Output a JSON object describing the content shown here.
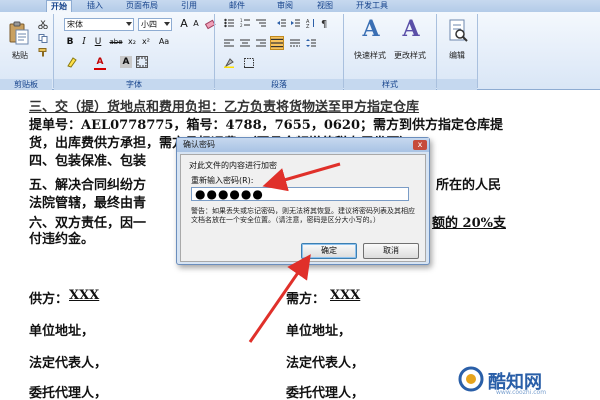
{
  "ribbon": {
    "tabs": [
      "开始",
      "插入",
      "页面布局",
      "引用",
      "邮件",
      "审阅",
      "视图",
      "开发工具"
    ],
    "active_tab": "开始",
    "clipboard": {
      "paste_label": "粘贴",
      "group_label": "剪贴板"
    },
    "font": {
      "font_name": "宋体",
      "font_size": "小四",
      "group_label": "字体",
      "buttons": [
        "B",
        "I",
        "U",
        "abe",
        "x₂",
        "x²",
        "Aa",
        "A",
        "A"
      ]
    },
    "paragraph": {
      "group_label": "段落"
    },
    "styles": {
      "quick_styles_label": "快速样式",
      "change_styles_label": "更改样式",
      "group_label": "样式"
    },
    "editing": {
      "label": "编辑"
    }
  },
  "document": {
    "lines": [
      "三、交（提）货地点和费用负担：乙方负责将货物送至甲方指定仓库",
      "提单号：AEL0778775，箱号：4788，7655，0620；需方到供方指定仓库提",
      "货，出库费供方承担，需方承担运费。（开具全额增值税专用发票）。",
      "四、包装保准、包装",
      "五、解决合同纠纷方",
      "法院管辖，最终由青",
      "六、双方责任，因一",
      "付违约金。"
    ],
    "right_fragments": [
      "所在的人民",
      "额的 20%支"
    ],
    "signature": {
      "buyer_label": "供方：",
      "buyer_value": "XXX",
      "seller_label": "需方：",
      "seller_value": "XXX",
      "address_label": "单位地址，",
      "legal_rep_label": "法定代表人，",
      "agent_label": "委托代理人，"
    }
  },
  "dialog": {
    "title": "确认密码",
    "close": "x",
    "description": "对此文件的内容进行加密",
    "prompt": "重新输入密码(R):",
    "password": "●●●●●●",
    "warning": "警告：如果丢失或忘记密码，则无法将其恢复。建议将密码列表及其相应文档名放在一个安全位置。（请注意，密码是区分大小写的。）",
    "ok_label": "确定",
    "cancel_label": "取消"
  },
  "watermark": {
    "brand": "酷知网",
    "url": "www.coozhi.com"
  }
}
